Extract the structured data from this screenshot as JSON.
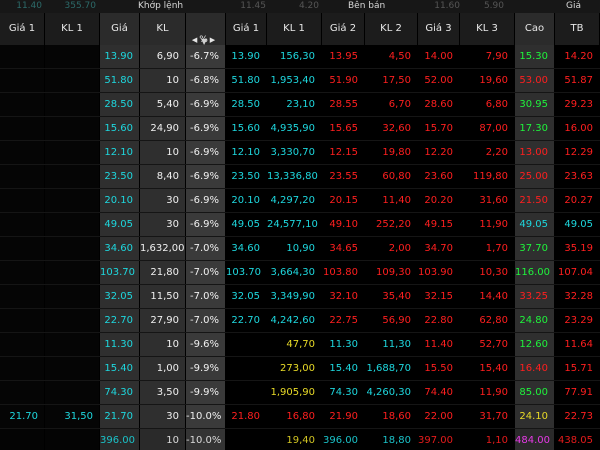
{
  "colors": {
    "ceiling": "#ff40ff",
    "up": "#1ff33c",
    "reference": "#e8da27",
    "down": "#ff1f1f",
    "floor": "#1ed7de"
  },
  "top_groups": {
    "left_faded_1": "11.40",
    "left_faded_2": "355.70",
    "match_group": "Khớp lệnh",
    "match_faded_1": "11.45",
    "match_faded_2": "4.20",
    "sell_group": "Bên bán",
    "sell_faded_1": "11.60",
    "sell_faded_2": "5.90",
    "right_group": "Giá"
  },
  "headers": {
    "gia1_left": "Giá 1",
    "kl1_left": "KL 1",
    "gia_match": "Giá",
    "kl_match": "KL",
    "pct_match": "%",
    "sell_gia1": "Giá 1",
    "sell_kl1": "KL 1",
    "sell_gia2": "Giá 2",
    "sell_kl2": "KL 2",
    "sell_gia3": "Giá 3",
    "sell_kl3": "KL 3",
    "cao": "Cao",
    "tb": "TB"
  },
  "sort_icons": {
    "left": "arrow-left-icon",
    "right": "arrow-right-icon",
    "down": "sort-desc-icon"
  },
  "rows": [
    {
      "buy_gia1": "",
      "buy_kl1": "",
      "match_price": "13.90",
      "match_kl": "6,90",
      "match_pct": "-6.7%",
      "sell_gia1": "13.90",
      "sell_kl1": "156,30",
      "sell_gia2": "13.95",
      "sell_kl2": "4,50",
      "sell_gia3": "14.00",
      "sell_kl3": "7,90",
      "cao": "15.30",
      "tb": "14.20",
      "colors": {
        "match_price": "cyan",
        "sell_gia1": "cyan",
        "sell_kl1": "cyan",
        "sell_gia2": "red",
        "sell_kl2": "red",
        "sell_gia3": "red",
        "sell_kl3": "red",
        "cao": "green",
        "tb": "red"
      }
    },
    {
      "buy_gia1": "",
      "buy_kl1": "",
      "match_price": "51.80",
      "match_kl": "10",
      "match_pct": "-6.8%",
      "sell_gia1": "51.80",
      "sell_kl1": "1,953,40",
      "sell_gia2": "51.90",
      "sell_kl2": "17,50",
      "sell_gia3": "52.00",
      "sell_kl3": "19,60",
      "cao": "53.00",
      "tb": "51.87",
      "colors": {
        "match_price": "cyan",
        "sell_gia1": "cyan",
        "sell_kl1": "cyan",
        "sell_gia2": "red",
        "sell_kl2": "red",
        "sell_gia3": "red",
        "sell_kl3": "red",
        "cao": "red",
        "tb": "red"
      }
    },
    {
      "buy_gia1": "",
      "buy_kl1": "",
      "match_price": "28.50",
      "match_kl": "5,40",
      "match_pct": "-6.9%",
      "sell_gia1": "28.50",
      "sell_kl1": "23,10",
      "sell_gia2": "28.55",
      "sell_kl2": "6,70",
      "sell_gia3": "28.60",
      "sell_kl3": "6,80",
      "cao": "30.95",
      "tb": "29.23",
      "colors": {
        "match_price": "cyan",
        "sell_gia1": "cyan",
        "sell_kl1": "cyan",
        "sell_gia2": "red",
        "sell_kl2": "red",
        "sell_gia3": "red",
        "sell_kl3": "red",
        "cao": "green",
        "tb": "red"
      }
    },
    {
      "buy_gia1": "",
      "buy_kl1": "",
      "match_price": "15.60",
      "match_kl": "24,90",
      "match_pct": "-6.9%",
      "sell_gia1": "15.60",
      "sell_kl1": "4,935,90",
      "sell_gia2": "15.65",
      "sell_kl2": "32,60",
      "sell_gia3": "15.70",
      "sell_kl3": "87,00",
      "cao": "17.30",
      "tb": "16.00",
      "colors": {
        "match_price": "cyan",
        "sell_gia1": "cyan",
        "sell_kl1": "cyan",
        "sell_gia2": "red",
        "sell_kl2": "red",
        "sell_gia3": "red",
        "sell_kl3": "red",
        "cao": "green",
        "tb": "red"
      }
    },
    {
      "buy_gia1": "",
      "buy_kl1": "",
      "match_price": "12.10",
      "match_kl": "10",
      "match_pct": "-6.9%",
      "sell_gia1": "12.10",
      "sell_kl1": "3,330,70",
      "sell_gia2": "12.15",
      "sell_kl2": "19,80",
      "sell_gia3": "12.20",
      "sell_kl3": "2,20",
      "cao": "13.00",
      "tb": "12.29",
      "colors": {
        "match_price": "cyan",
        "sell_gia1": "cyan",
        "sell_kl1": "cyan",
        "sell_gia2": "red",
        "sell_kl2": "red",
        "sell_gia3": "red",
        "sell_kl3": "red",
        "cao": "red",
        "tb": "red"
      }
    },
    {
      "buy_gia1": "",
      "buy_kl1": "",
      "match_price": "23.50",
      "match_kl": "8,40",
      "match_pct": "-6.9%",
      "sell_gia1": "23.50",
      "sell_kl1": "13,336,80",
      "sell_gia2": "23.55",
      "sell_kl2": "60,80",
      "sell_gia3": "23.60",
      "sell_kl3": "119,80",
      "cao": "25.00",
      "tb": "23.63",
      "colors": {
        "match_price": "cyan",
        "sell_gia1": "cyan",
        "sell_kl1": "cyan",
        "sell_gia2": "red",
        "sell_kl2": "red",
        "sell_gia3": "red",
        "sell_kl3": "red",
        "cao": "red",
        "tb": "red"
      }
    },
    {
      "buy_gia1": "",
      "buy_kl1": "",
      "match_price": "20.10",
      "match_kl": "30",
      "match_pct": "-6.9%",
      "sell_gia1": "20.10",
      "sell_kl1": "4,297,20",
      "sell_gia2": "20.15",
      "sell_kl2": "11,40",
      "sell_gia3": "20.20",
      "sell_kl3": "31,60",
      "cao": "21.50",
      "tb": "20.27",
      "colors": {
        "match_price": "cyan",
        "sell_gia1": "cyan",
        "sell_kl1": "cyan",
        "sell_gia2": "red",
        "sell_kl2": "red",
        "sell_gia3": "red",
        "sell_kl3": "red",
        "cao": "red",
        "tb": "red"
      }
    },
    {
      "buy_gia1": "",
      "buy_kl1": "",
      "match_price": "49.05",
      "match_kl": "30",
      "match_pct": "-6.9%",
      "sell_gia1": "49.05",
      "sell_kl1": "24,577,10",
      "sell_gia2": "49.10",
      "sell_kl2": "252,20",
      "sell_gia3": "49.15",
      "sell_kl3": "11,90",
      "cao": "49.05",
      "tb": "49.05",
      "colors": {
        "match_price": "cyan",
        "sell_gia1": "cyan",
        "sell_kl1": "cyan",
        "sell_gia2": "red",
        "sell_kl2": "red",
        "sell_gia3": "red",
        "sell_kl3": "red",
        "cao": "cyan",
        "tb": "cyan"
      }
    },
    {
      "buy_gia1": "",
      "buy_kl1": "",
      "match_price": "34.60",
      "match_kl": "1,632,00",
      "match_pct": "-7.0%",
      "sell_gia1": "34.60",
      "sell_kl1": "10,90",
      "sell_gia2": "34.65",
      "sell_kl2": "2,00",
      "sell_gia3": "34.70",
      "sell_kl3": "1,70",
      "cao": "37.70",
      "tb": "35.19",
      "colors": {
        "match_price": "cyan",
        "sell_gia1": "cyan",
        "sell_kl1": "cyan",
        "sell_gia2": "red",
        "sell_kl2": "red",
        "sell_gia3": "red",
        "sell_kl3": "red",
        "cao": "green",
        "tb": "red"
      }
    },
    {
      "buy_gia1": "",
      "buy_kl1": "",
      "match_price": "103.70",
      "match_kl": "21,80",
      "match_pct": "-7.0%",
      "sell_gia1": "103.70",
      "sell_kl1": "3,664,30",
      "sell_gia2": "103.80",
      "sell_kl2": "109,30",
      "sell_gia3": "103.90",
      "sell_kl3": "10,30",
      "cao": "116.00",
      "tb": "107.04",
      "colors": {
        "match_price": "cyan",
        "sell_gia1": "cyan",
        "sell_kl1": "cyan",
        "sell_gia2": "red",
        "sell_kl2": "red",
        "sell_gia3": "red",
        "sell_kl3": "red",
        "cao": "green",
        "tb": "red"
      }
    },
    {
      "buy_gia1": "",
      "buy_kl1": "",
      "match_price": "32.05",
      "match_kl": "11,50",
      "match_pct": "-7.0%",
      "sell_gia1": "32.05",
      "sell_kl1": "3,349,90",
      "sell_gia2": "32.10",
      "sell_kl2": "35,40",
      "sell_gia3": "32.15",
      "sell_kl3": "14,40",
      "cao": "33.25",
      "tb": "32.28",
      "colors": {
        "match_price": "cyan",
        "sell_gia1": "cyan",
        "sell_kl1": "cyan",
        "sell_gia2": "red",
        "sell_kl2": "red",
        "sell_gia3": "red",
        "sell_kl3": "red",
        "cao": "red",
        "tb": "red"
      }
    },
    {
      "buy_gia1": "",
      "buy_kl1": "",
      "match_price": "22.70",
      "match_kl": "27,90",
      "match_pct": "-7.0%",
      "sell_gia1": "22.70",
      "sell_kl1": "4,242,60",
      "sell_gia2": "22.75",
      "sell_kl2": "56,90",
      "sell_gia3": "22.80",
      "sell_kl3": "62,80",
      "cao": "24.80",
      "tb": "23.29",
      "colors": {
        "match_price": "cyan",
        "sell_gia1": "cyan",
        "sell_kl1": "cyan",
        "sell_gia2": "red",
        "sell_kl2": "red",
        "sell_gia3": "red",
        "sell_kl3": "red",
        "cao": "green",
        "tb": "red"
      }
    },
    {
      "buy_gia1": "",
      "buy_kl1": "",
      "match_price": "11.30",
      "match_kl": "10",
      "match_pct": "-9.6%",
      "sell_gia1": "",
      "sell_kl1": "47,70",
      "sell_gia2": "11.30",
      "sell_kl2": "11,30",
      "sell_gia3": "11.40",
      "sell_kl3": "52,70",
      "cao": "12.60",
      "tb": "11.64",
      "colors": {
        "match_price": "cyan",
        "sell_gia1": "white",
        "sell_kl1": "yellow",
        "sell_gia2": "cyan",
        "sell_kl2": "cyan",
        "sell_gia3": "red",
        "sell_kl3": "red",
        "cao": "green",
        "tb": "red"
      }
    },
    {
      "buy_gia1": "",
      "buy_kl1": "",
      "match_price": "15.40",
      "match_kl": "1,00",
      "match_pct": "-9.9%",
      "sell_gia1": "",
      "sell_kl1": "273,00",
      "sell_gia2": "15.40",
      "sell_kl2": "1,688,70",
      "sell_gia3": "15.50",
      "sell_kl3": "15,40",
      "cao": "16.40",
      "tb": "15.71",
      "colors": {
        "match_price": "cyan",
        "sell_gia1": "white",
        "sell_kl1": "yellow",
        "sell_gia2": "cyan",
        "sell_kl2": "cyan",
        "sell_gia3": "red",
        "sell_kl3": "red",
        "cao": "red",
        "tb": "red"
      }
    },
    {
      "buy_gia1": "",
      "buy_kl1": "",
      "match_price": "74.30",
      "match_kl": "3,50",
      "match_pct": "-9.9%",
      "sell_gia1": "",
      "sell_kl1": "1,905,90",
      "sell_gia2": "74.30",
      "sell_kl2": "4,260,30",
      "sell_gia3": "74.40",
      "sell_kl3": "11,90",
      "cao": "85.00",
      "tb": "77.91",
      "colors": {
        "match_price": "cyan",
        "sell_gia1": "white",
        "sell_kl1": "yellow",
        "sell_gia2": "cyan",
        "sell_kl2": "cyan",
        "sell_gia3": "red",
        "sell_kl3": "red",
        "cao": "green",
        "tb": "red"
      }
    },
    {
      "buy_gia1": "21.70",
      "buy_kl1": "31,50",
      "match_price": "21.70",
      "match_kl": "30",
      "match_pct": "-10.0%",
      "sell_gia1": "21.80",
      "sell_kl1": "16,80",
      "sell_gia2": "21.90",
      "sell_kl2": "18,60",
      "sell_gia3": "22.00",
      "sell_kl3": "31,70",
      "cao": "24.10",
      "tb": "22.73",
      "colors": {
        "buy_gia1": "cyan",
        "buy_kl1": "cyan",
        "match_price": "cyan",
        "sell_gia1": "red",
        "sell_kl1": "red",
        "sell_gia2": "red",
        "sell_kl2": "red",
        "sell_gia3": "red",
        "sell_kl3": "red",
        "cao": "yellow",
        "tb": "red"
      }
    },
    {
      "buy_gia1": "",
      "buy_kl1": "",
      "match_price": "396.00",
      "match_kl": "10",
      "match_pct": "-10.0%",
      "sell_gia1": "",
      "sell_kl1": "19,40",
      "sell_gia2": "396.00",
      "sell_kl2": "18,80",
      "sell_gia3": "397.00",
      "sell_kl3": "1,10",
      "cao": "484.00",
      "tb": "438.05",
      "colors": {
        "match_price": "cyan",
        "sell_gia1": "white",
        "sell_kl1": "yellow",
        "sell_gia2": "cyan",
        "sell_kl2": "cyan",
        "sell_gia3": "red",
        "sell_kl3": "red",
        "cao": "magenta",
        "tb": "red"
      }
    }
  ]
}
